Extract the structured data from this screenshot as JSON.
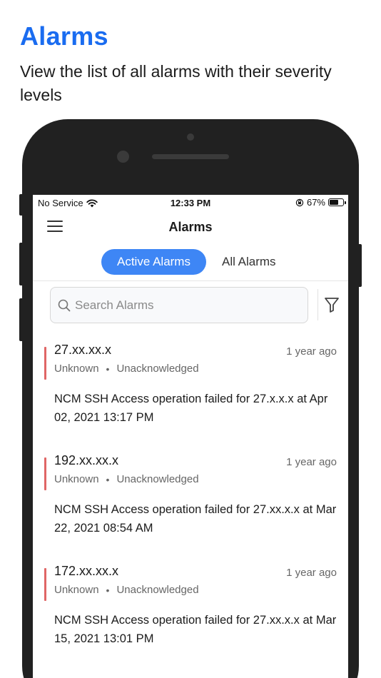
{
  "promo": {
    "heading": "Alarms",
    "subheading": "View the list of all alarms with their severity levels"
  },
  "statusbar": {
    "carrier": "No Service",
    "time": "12:33 PM",
    "battery": "67%",
    "battery_level": 0.67
  },
  "navbar": {
    "title": "Alarms"
  },
  "tabs": [
    {
      "label": "Active Alarms",
      "selected": true
    },
    {
      "label": "All Alarms",
      "selected": false
    }
  ],
  "search": {
    "placeholder": "Search Alarms"
  },
  "alarms": [
    {
      "host": "27.xx.xx.x",
      "time": "1 year ago",
      "severity": "Unknown",
      "status": "Unacknowledged",
      "message": "NCM SSH Access operation failed for 27.x.x.x at Apr 02, 2021 13:17 PM"
    },
    {
      "host": "192.xx.xx.x",
      "time": "1 year ago",
      "severity": "Unknown",
      "status": "Unacknowledged",
      "message": "NCM SSH Access operation failed for 27.xx.x.x at Mar 22, 2021 08:54 AM"
    },
    {
      "host": "172.xx.xx.x",
      "time": "1 year ago",
      "severity": "Unknown",
      "status": "Unacknowledged",
      "message": "NCM SSH Access operation failed for 27.xx.x.x at Mar 15, 2021 13:01 PM"
    }
  ],
  "colors": {
    "accent": "#1a6cf0",
    "tab_active": "#3e86f5",
    "severity_bar": "#e06666",
    "phone_frame": "#212121"
  }
}
